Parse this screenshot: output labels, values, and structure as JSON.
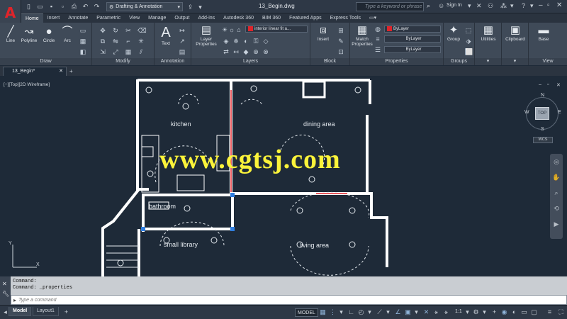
{
  "app": {
    "title": "13_Begin.dwg",
    "workspace": "Drafting & Annotation",
    "search_placeholder": "Type a keyword or phrase",
    "sign_in": "Sign In"
  },
  "ribbon_tabs": [
    {
      "label": "Home",
      "active": true
    },
    {
      "label": "Insert"
    },
    {
      "label": "Annotate"
    },
    {
      "label": "Parametric"
    },
    {
      "label": "View"
    },
    {
      "label": "Manage"
    },
    {
      "label": "Output"
    },
    {
      "label": "Add-ins"
    },
    {
      "label": "Autodesk 360"
    },
    {
      "label": "BIM 360"
    },
    {
      "label": "Featured Apps"
    },
    {
      "label": "Express Tools"
    }
  ],
  "panels": {
    "draw": {
      "title": "Draw",
      "tools": [
        "Line",
        "Polyline",
        "Circle",
        "Arc"
      ]
    },
    "modify": {
      "title": "Modify"
    },
    "annotation": {
      "title": "Annotation",
      "tools": [
        "Text"
      ]
    },
    "layers": {
      "title": "Layers",
      "layer_properties": "Layer Properties",
      "current_layer": "interior linear fit a..."
    },
    "block": {
      "title": "Block",
      "insert": "Insert"
    },
    "properties": {
      "title": "Properties",
      "match": "Match Properties",
      "color": "ByLayer",
      "linetype": "ByLayer",
      "lineweight": "ByLayer"
    },
    "groups": {
      "title": "Groups",
      "group": "Group"
    },
    "utilities": {
      "label": "Utilities"
    },
    "clipboard": {
      "label": "Clipboard"
    },
    "view": {
      "title": "View",
      "base": "Base"
    }
  },
  "document": {
    "tab": "13_Begin*",
    "viewport_label": "[−][Top][2D Wireframe]"
  },
  "drawing": {
    "rooms": [
      "kitchen",
      "dining area",
      "bathroom",
      "small library",
      "living area"
    ]
  },
  "watermark": "www.cgtsj.com",
  "viewcube": {
    "top": "TOP",
    "n": "N",
    "s": "S",
    "e": "E",
    "w": "W",
    "wcs": "WCS"
  },
  "ucs": {
    "x": "X",
    "y": "Y"
  },
  "command": {
    "history": [
      "Command:",
      "Command: _properties"
    ],
    "placeholder": "Type a command"
  },
  "status": {
    "layout_tabs": [
      "Model",
      "Layout1"
    ],
    "model_button": "MODEL",
    "scale": "1:1"
  },
  "colors": {
    "accent_red": "#e0242a",
    "watermark_yellow": "#fbf33a",
    "canvas": "#1e2a38"
  }
}
